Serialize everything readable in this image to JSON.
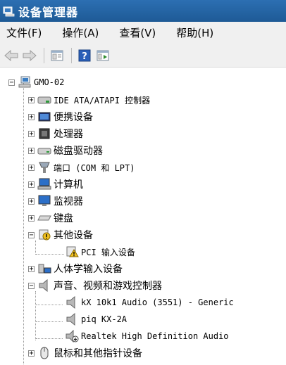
{
  "window": {
    "title": "设备管理器"
  },
  "menu": [
    {
      "label": "文件(F)"
    },
    {
      "label": "操作(A)"
    },
    {
      "label": "查看(V)"
    },
    {
      "label": "帮助(H)"
    }
  ],
  "toolbar": {
    "back": "back-arrow-icon",
    "forward": "forward-arrow-icon",
    "properties": "properties-icon",
    "help": "help-icon",
    "update": "update-driver-icon",
    "help_glyph": "?"
  },
  "tree": {
    "root": "GMO-02",
    "expand_glyph": "+",
    "collapse_glyph": "−",
    "items": [
      {
        "label": "IDE ATA/ATAPI 控制器"
      },
      {
        "label": "便携设备"
      },
      {
        "label": "处理器"
      },
      {
        "label": "磁盘驱动器"
      },
      {
        "label": "端口 (COM 和 LPT)"
      },
      {
        "label": "计算机"
      },
      {
        "label": "监视器"
      },
      {
        "label": "键盘"
      },
      {
        "label": "其他设备"
      },
      {
        "label": "PCI 输入设备"
      },
      {
        "label": "人体学输入设备"
      },
      {
        "label": "声音、视频和游戏控制器"
      },
      {
        "label": "kX 10k1 Audio (3551) - Generic"
      },
      {
        "label": "piq KX-2A"
      },
      {
        "label": "Realtek High Definition Audio"
      },
      {
        "label": "鼠标和其他指针设备"
      }
    ]
  }
}
